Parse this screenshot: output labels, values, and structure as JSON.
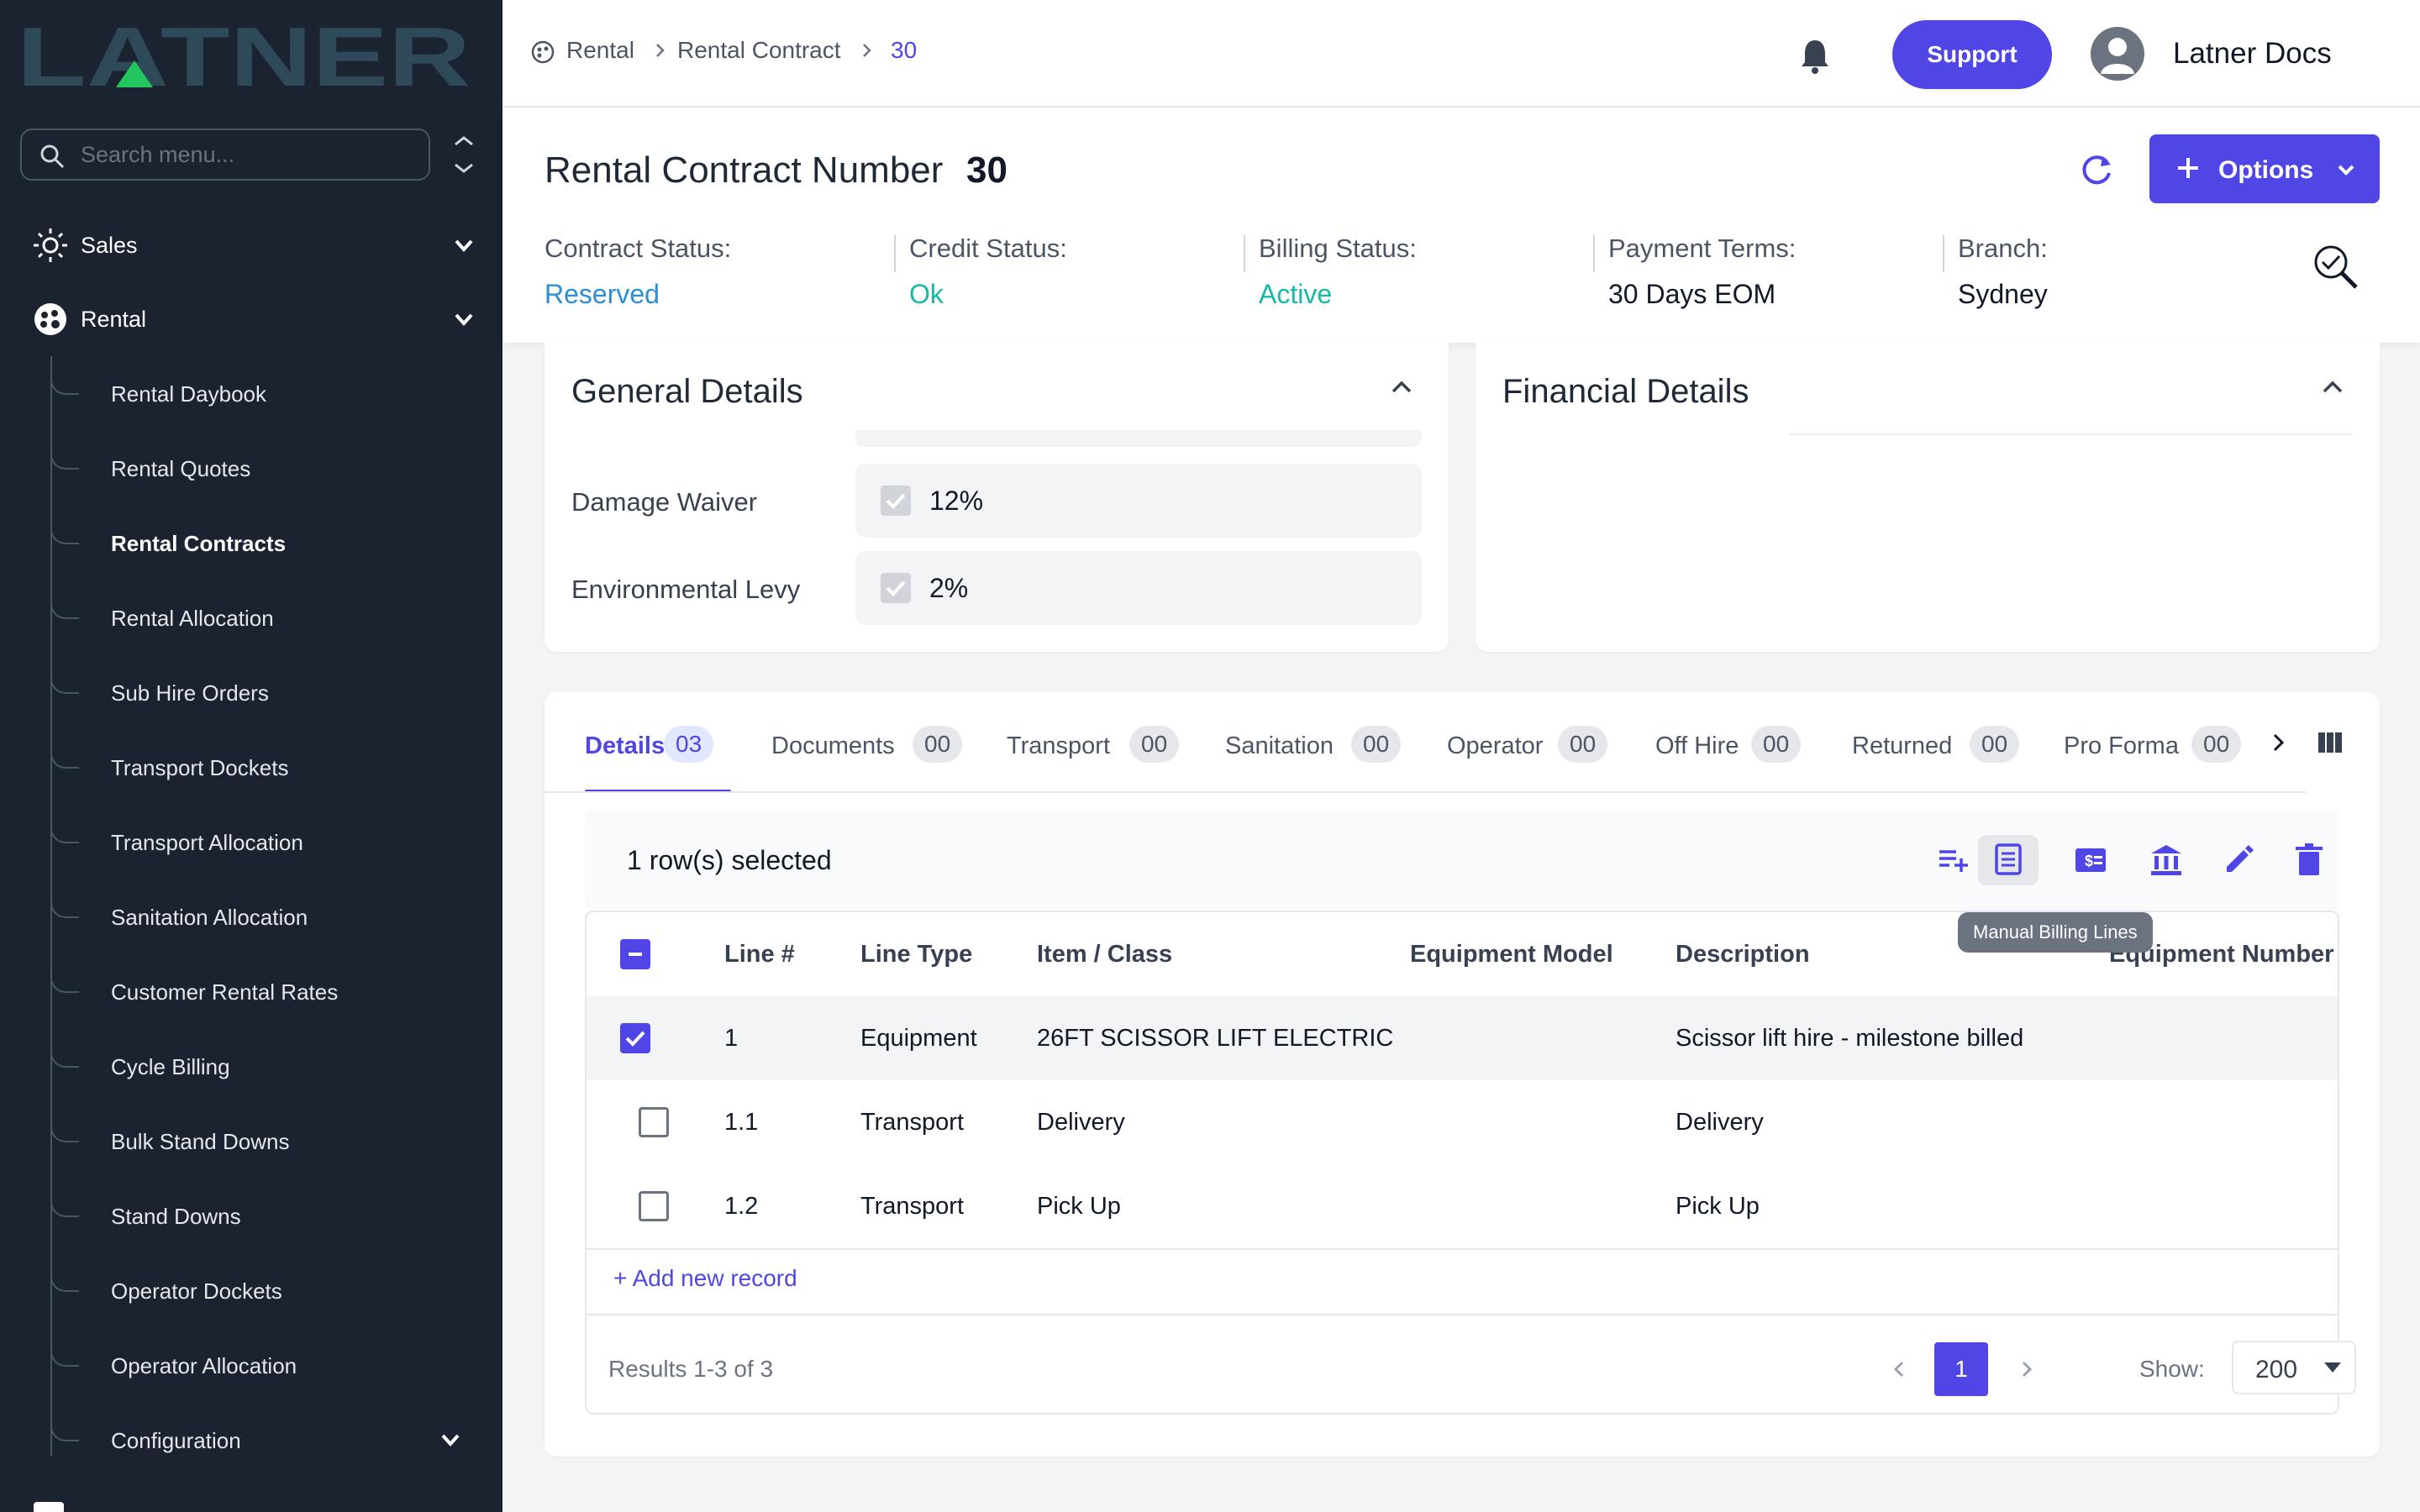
{
  "app": {
    "logo_text": "LATNER"
  },
  "sidebar": {
    "search_placeholder": "Search menu...",
    "top_items": [
      {
        "label": "Sales",
        "icon": "sales-icon"
      },
      {
        "label": "Rental",
        "icon": "rental-icon"
      }
    ],
    "rental_items": [
      "Rental Daybook",
      "Rental Quotes",
      "Rental Contracts",
      "Rental Allocation",
      "Sub Hire Orders",
      "Transport Dockets",
      "Transport Allocation",
      "Sanitation Allocation",
      "Customer Rental Rates",
      "Cycle Billing",
      "Bulk Stand Downs",
      "Stand Downs",
      "Operator Dockets",
      "Operator Allocation",
      "Configuration"
    ],
    "active_item": "Rental Contracts"
  },
  "topbar": {
    "breadcrumb": [
      "Rental",
      "Rental Contract",
      "30"
    ],
    "support_label": "Support",
    "user_name": "Latner Docs"
  },
  "header": {
    "title_label": "Rental Contract Number",
    "title_number": "30",
    "options_label": "Options",
    "stats": [
      {
        "label": "Contract Status:",
        "value": "Reserved",
        "color": "#2b8fd6"
      },
      {
        "label": "Credit Status:",
        "value": "Ok",
        "color": "#16b8a6"
      },
      {
        "label": "Billing Status:",
        "value": "Active",
        "color": "#16b8a6"
      },
      {
        "label": "Payment Terms:",
        "value": "30 Days EOM",
        "color": "#111827"
      },
      {
        "label": "Branch:",
        "value": "Sydney",
        "color": "#111827"
      }
    ]
  },
  "general_details": {
    "title": "General Details",
    "fields": [
      {
        "label": "Damage Waiver",
        "value": "12%",
        "checked": true
      },
      {
        "label": "Environmental Levy",
        "value": "2%",
        "checked": true
      }
    ]
  },
  "financial_details": {
    "title": "Financial Details"
  },
  "tabs": [
    {
      "label": "Details",
      "count": "03",
      "active": true
    },
    {
      "label": "Documents",
      "count": "00"
    },
    {
      "label": "Transport",
      "count": "00"
    },
    {
      "label": "Sanitation",
      "count": "00"
    },
    {
      "label": "Operator",
      "count": "00"
    },
    {
      "label": "Off Hire",
      "count": "00"
    },
    {
      "label": "Returned",
      "count": "00"
    },
    {
      "label": "Pro Forma",
      "count": "00"
    }
  ],
  "toolbar": {
    "selection_text": "1 row(s) selected",
    "tooltip": "Manual Billing Lines",
    "icons": [
      "add-line-icon",
      "manual-billing-lines-icon",
      "invoice-icon",
      "bank-icon",
      "edit-icon",
      "delete-icon"
    ]
  },
  "grid": {
    "columns": [
      "Line #",
      "Line Type",
      "Item / Class",
      "Equipment Model",
      "Description",
      "Equipment Number"
    ],
    "rows": [
      {
        "line": "1",
        "type": "Equipment",
        "item": "26FT SCISSOR LIFT ELECTRIC",
        "model": "",
        "description": "Scissor lift hire - milestone billed",
        "number": "",
        "selected": true
      },
      {
        "line": "1.1",
        "type": "Transport",
        "item": "Delivery",
        "model": "",
        "description": "Delivery",
        "number": "",
        "selected": false
      },
      {
        "line": "1.2",
        "type": "Transport",
        "item": "Pick Up",
        "model": "",
        "description": "Pick Up",
        "number": "",
        "selected": false
      }
    ],
    "add_record": "+ Add new record",
    "results": "Results 1-3 of 3",
    "current_page": "1",
    "show_label": "Show:",
    "page_size": "200"
  },
  "colors": {
    "accent": "#4f46e5",
    "sidebar_bg": "#1b2230",
    "logo": "#2e4a58",
    "logo_triangle": "#22c55e"
  }
}
